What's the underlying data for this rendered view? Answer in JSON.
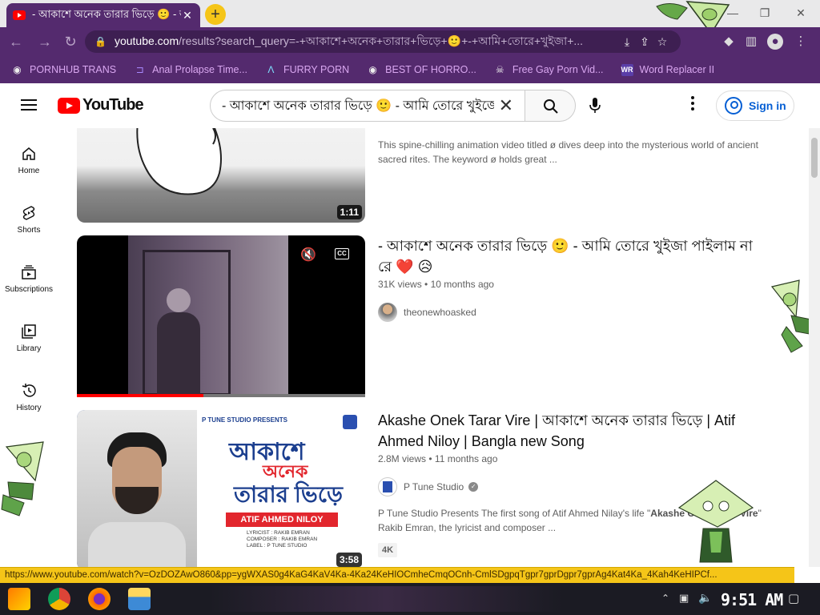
{
  "browser": {
    "tab_title": "- আকাশে অনেক তারার ভিড়ে 🙂 - আমি",
    "url_host": "youtube.com",
    "url_path": "/results?search_query=-+আকাশে+অনেক+তারার+ভিড়ে+🙂+-+আমি+তোরে+খুইজা+...",
    "bookmarks": [
      {
        "label": "PORNHUB TRANS",
        "icon": "globe-icon"
      },
      {
        "label": "Anal Prolapse Time...",
        "icon": "bracket-icon"
      },
      {
        "label": "FURRY PORN",
        "icon": "arrow-up-icon"
      },
      {
        "label": "BEST OF HORRO...",
        "icon": "globe-icon"
      },
      {
        "label": "Free Gay Porn Vid...",
        "icon": "skull-icon"
      },
      {
        "label": "Word Replacer II",
        "icon": "wr-icon"
      }
    ]
  },
  "youtube": {
    "logo_text": "YouTube",
    "search_query": "- আকাশে অনেক তারার ভিড়ে 🙂 - আমি তোরে খুইজে",
    "sign_in": "Sign in",
    "nav": [
      {
        "label": "Home",
        "icon": "home-icon"
      },
      {
        "label": "Shorts",
        "icon": "shorts-icon"
      },
      {
        "label": "Subscriptions",
        "icon": "subscriptions-icon"
      },
      {
        "label": "Library",
        "icon": "library-icon"
      },
      {
        "label": "History",
        "icon": "history-icon"
      }
    ],
    "results": [
      {
        "duration": "1:11",
        "desc": "This spine-chilling animation video titled ø dives deep into the mysterious world of ancient sacred rites. The keyword ø holds great ..."
      },
      {
        "title": "- আকাশে অনেক তারার ভিড়ে 🙂 - আমি তোরে খুইজা পাইলাম না রে ❤️ 😥",
        "views": "31K views",
        "age": "10 months ago",
        "channel": "theonewhoasked"
      },
      {
        "title": "Akashe Onek Tarar Vire | আকাশে অনেক তারার ভিড়ে | Atif Ahmed Niloy | Bangla new Song",
        "views": "2.8M views",
        "age": "11 months ago",
        "channel": "P Tune Studio",
        "desc_prefix": "P Tune Studio Presents The first song of Atif Ahmed Nilay's life \"",
        "desc_bold": "Akashe Onek Tarar Vire",
        "desc_suffix": "\" Rakib Emran, the lyricist and composer ...",
        "badge": "4K",
        "duration": "3:58",
        "thumb_studio": "P TUNE STUDIO PRESENTS",
        "thumb_title_1": "আকাশে",
        "thumb_title_2": "অনেক",
        "thumb_title_3": "তারার ভিড়ে",
        "thumb_artist": "ATIF AHMED NILOY",
        "thumb_credits": "LYRICIST : RAKIB EMRAN\nCOMPOSER : RAKIB EMRAN\nLABEL : P TUNE STUDIO"
      }
    ]
  },
  "status_url": "https://www.youtube.com/watch?v=OzDOZAwO860&pp=ygWXAS0g4KaG4KaV4Ka-4Ka24KeHIOCmheCmqOCnh-CmlSDgpqTgpr7gprDgpr7gprAg4Kat4Ka_4Kah4KeHIPCf...",
  "taskbar": {
    "clock": "9:51 AM"
  }
}
